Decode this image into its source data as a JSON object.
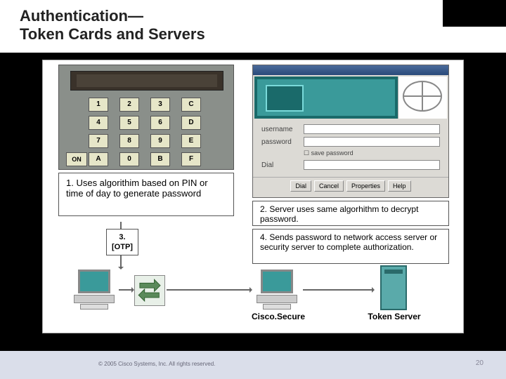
{
  "header": {
    "title_line1": "Authentication—",
    "title_line2": "Token Cards and Servers"
  },
  "token_card": {
    "keys": {
      "r1": [
        "1",
        "2",
        "3",
        "C"
      ],
      "r2": [
        "4",
        "5",
        "6",
        "D"
      ],
      "r3": [
        "7",
        "8",
        "9",
        "E"
      ],
      "r4": [
        "A",
        "0",
        "B",
        "F"
      ],
      "on": "ON"
    }
  },
  "boxes": {
    "box1": "1. Uses algorithim based on PIN or time of day to generate password",
    "otp_line1": "3.",
    "otp_line2": "[OTP]",
    "box2": "2. Server uses same algorhithm to decrypt password.",
    "box4": "4. Sends password to network access server or security server to complete authorization."
  },
  "login": {
    "username_label": "username",
    "password_label": "password",
    "save_label": "save password",
    "dial_label": "Dial",
    "buttons": [
      "Dial",
      "Cancel",
      "Properties",
      "Help"
    ]
  },
  "labels": {
    "cisco_secure": "Cisco.Secure",
    "token_server": "Token Server"
  },
  "footer": {
    "copyright": "© 2005 Cisco Systems, Inc. All rights reserved.",
    "page": "20"
  }
}
